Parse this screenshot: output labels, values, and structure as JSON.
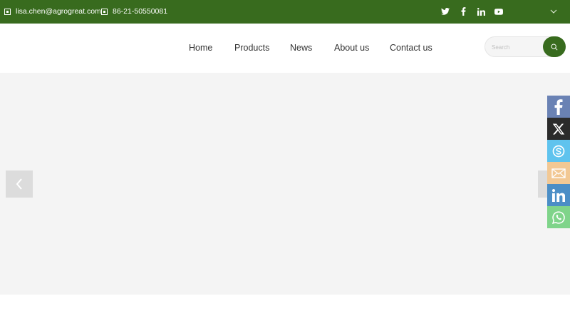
{
  "topbar": {
    "email": "lisa.chen@agrogreat.com",
    "phone": "86-21-50550081",
    "social_icons": [
      "twitter-icon",
      "facebook-icon",
      "linkedin-icon",
      "youtube-icon"
    ],
    "background": "#386b1e"
  },
  "nav": {
    "items": [
      {
        "label": "Home"
      },
      {
        "label": "Products"
      },
      {
        "label": "News"
      },
      {
        "label": "About us"
      },
      {
        "label": "Contact us"
      }
    ]
  },
  "search": {
    "placeholder": "Search",
    "button_icon": "search-icon"
  },
  "banner": {
    "prev_icon": "chevron-left-icon",
    "next_icon": "chevron-right-icon"
  },
  "side_social": [
    {
      "name": "facebook",
      "color": "#6a82b4"
    },
    {
      "name": "x",
      "color": "#2b2b2b"
    },
    {
      "name": "skype",
      "color": "#5fc3ee"
    },
    {
      "name": "email",
      "color": "#f2c894"
    },
    {
      "name": "linkedin",
      "color": "#4b8ec6"
    },
    {
      "name": "whatsapp",
      "color": "#7fd48a"
    }
  ],
  "colors": {
    "brand_green": "#386b1e",
    "banner_bg": "#f4f4f4"
  }
}
